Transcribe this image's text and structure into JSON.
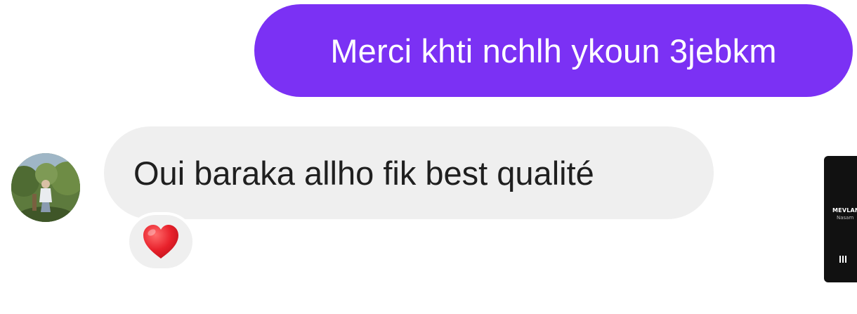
{
  "conversation": {
    "messages": [
      {
        "direction": "outgoing",
        "text": "Merci khti nchlh ykoun 3jebkm",
        "bubble_color": "#7b31f4"
      },
      {
        "direction": "incoming",
        "text": "Oui baraka allho fik best qualité",
        "bubble_color": "#efefef",
        "reaction": {
          "emoji": "❤️",
          "icon": "heart-icon",
          "color": "#e8212b"
        }
      }
    ]
  },
  "music_widget": {
    "artist": "MEVLAN",
    "track": "Nasam",
    "control_icon": "pause-icon"
  }
}
